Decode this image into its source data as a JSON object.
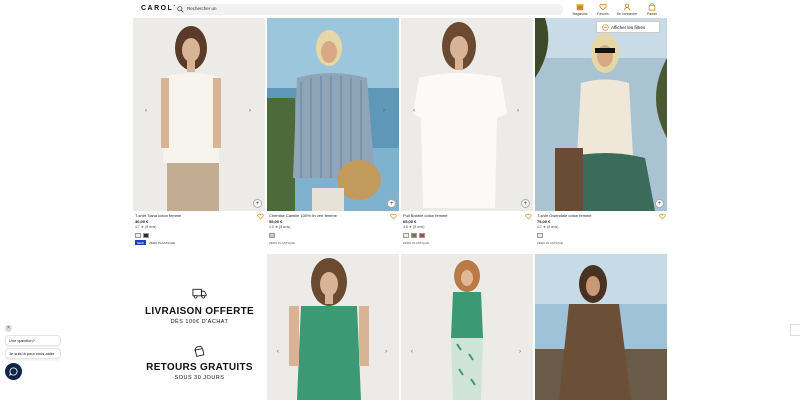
{
  "header": {
    "logo": "CAROLL",
    "search_placeholder": "Rechercher un",
    "nav": [
      {
        "label": "Magasins",
        "icon": "store-icon"
      },
      {
        "label": "Favoris",
        "icon": "heart-icon"
      },
      {
        "label": "Se connecter",
        "icon": "user-icon"
      },
      {
        "label": "Panier",
        "icon": "bag-icon"
      }
    ]
  },
  "filters_button": "Afficher les filtres",
  "products": [
    {
      "name": "T-shirt Tiana coton femme",
      "price": "30,00 €",
      "rating": "4.7",
      "reviews": "(8 avis)",
      "swatches": [
        "#f3efe6",
        "#3a2a20"
      ],
      "new": "NEW",
      "badge": "ZÉRO PLASTIQUE",
      "payment": ""
    },
    {
      "name": "Chemise Camille 100% lin vert femme",
      "price": "59,00 €",
      "rating": "4.6",
      "reviews": "(8 avis)",
      "swatches": [
        "#b9c7d6"
      ],
      "new": "",
      "badge": "",
      "payment": "ZÉRO PLASTIQUE"
    },
    {
      "name": "Pull Bobbie coton femme",
      "price": "65,00 €",
      "rating": "4.8",
      "reviews": "(8 avis)",
      "swatches": [
        "#f1ece2",
        "#8a6b4e",
        "#a1523a"
      ],
      "new": "",
      "badge": "",
      "payment": "ZÉRO PLASTIQUE"
    },
    {
      "name": "T-shirt Gwendale coton femme",
      "price": "75,00 €",
      "rating": "4.7",
      "reviews": "(8 avis)",
      "swatches": [
        "#f1ece2"
      ],
      "new": "",
      "badge": "",
      "payment": "ZÉRO PLASTIQUE"
    }
  ],
  "promos": [
    {
      "title": "LIVRAISON OFFERTE",
      "subtitle": "DÈS 100€ D'ACHAT",
      "icon": "truck-icon"
    },
    {
      "title": "RETOURS GRATUITS",
      "subtitle": "SOUS 30 JOURS",
      "icon": "return-icon"
    }
  ],
  "chat": {
    "question": "Une question?",
    "helper": "Je suis là pour vous aider"
  }
}
